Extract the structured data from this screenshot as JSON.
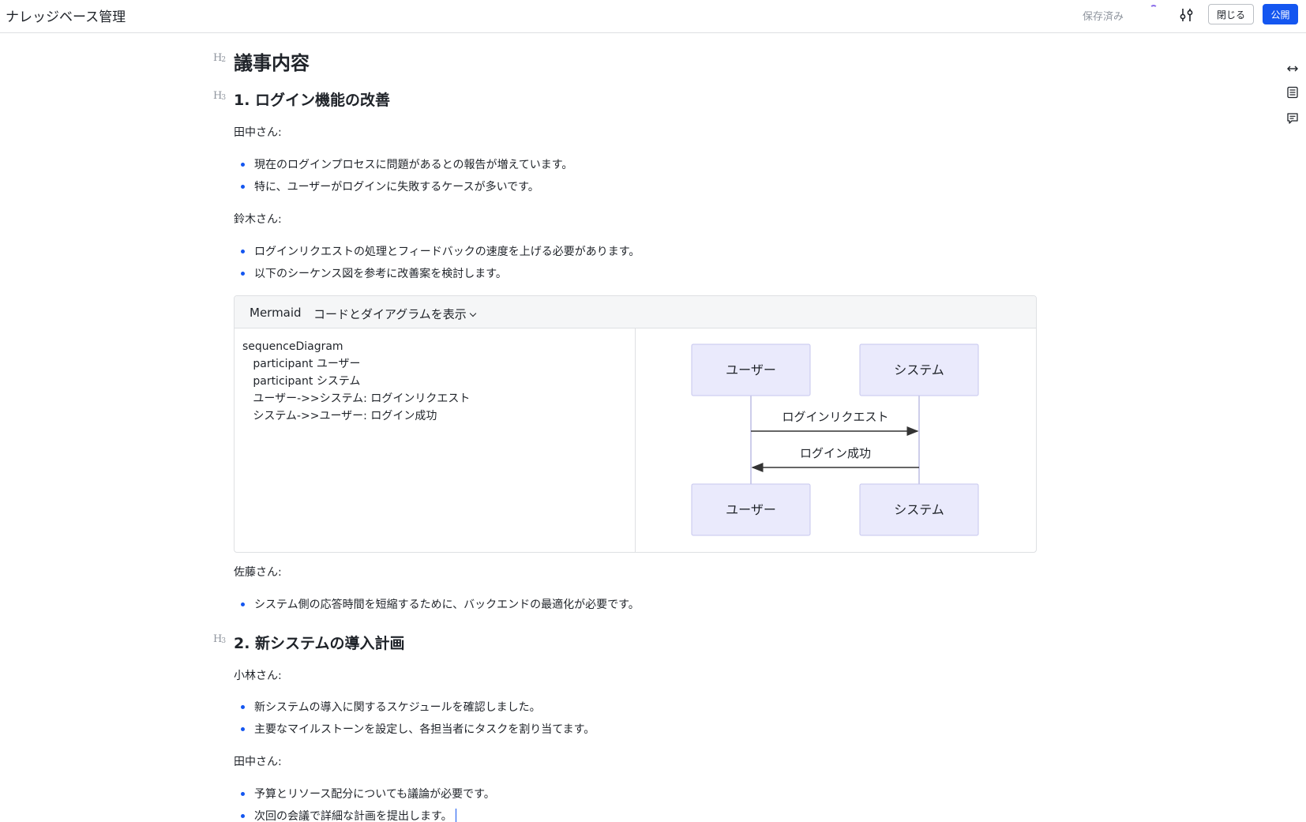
{
  "header": {
    "title": "ナレッジベース管理",
    "save_status": "保存済み",
    "close_label": "閉じる",
    "publish_label": "公開"
  },
  "heading_marks": {
    "h2": "H",
    "h2_level": "2",
    "h3": "H",
    "h3_level": "3"
  },
  "document": {
    "h2_title": "議事内容",
    "section1": {
      "title": "1. ログイン機能の改善",
      "speaker1": "田中さん:",
      "speaker1_items": [
        "現在のログインプロセスに問題があるとの報告が増えています。",
        "特に、ユーザーがログインに失敗するケースが多いです。"
      ],
      "speaker2": "鈴木さん:",
      "speaker2_items": [
        "ログインリクエストの処理とフィードバックの速度を上げる必要があります。",
        "以下のシーケンス図を参考に改善案を検討します。"
      ],
      "speaker3": "佐藤さん:",
      "speaker3_items": [
        "システム側の応答時間を短縮するために、バックエンドの最適化が必要です。"
      ]
    },
    "section2": {
      "title": "2. 新システムの導入計画",
      "speaker1": "小林さん:",
      "speaker1_items": [
        "新システムの導入に関するスケジュールを確認しました。",
        "主要なマイルストーンを設定し、各担当者にタスクを割り当てます。"
      ],
      "speaker2": "田中さん:",
      "speaker2_items": [
        "予算とリソース配分についても議論が必要です。",
        "次回の会議で詳細な計画を提出します。"
      ]
    }
  },
  "mermaid": {
    "language": "Mermaid",
    "view_mode": "コードとダイアグラムを表示",
    "code_lines": [
      "sequenceDiagram",
      "   participant ユーザー",
      "   participant システム",
      "   ユーザー->>システム: ログインリクエスト",
      "   システム->>ユーザー: ログイン成功"
    ],
    "diagram": {
      "participant_a": "ユーザー",
      "participant_b": "システム",
      "message1": "ログインリクエスト",
      "message2": "ログイン成功",
      "box_fill": "#eaeafc",
      "box_stroke": "#c7c7ee"
    }
  },
  "colors": {
    "accent": "#1456f0",
    "bullet": "#1456f0",
    "muted": "#8f959e"
  },
  "icons": [
    "sliders-icon",
    "expand-width-icon",
    "outline-icon",
    "comments-icon"
  ]
}
